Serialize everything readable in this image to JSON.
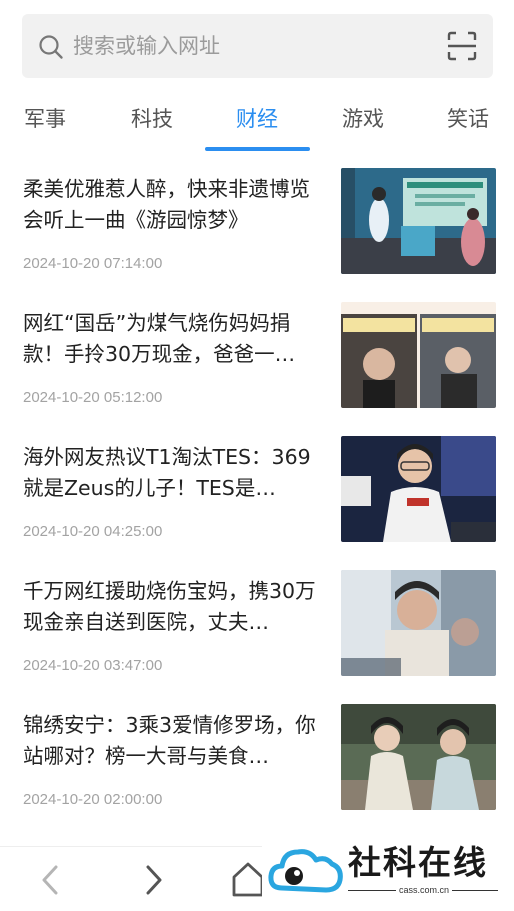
{
  "search": {
    "placeholder": "搜索或输入网址"
  },
  "tabs": [
    {
      "label": "军事"
    },
    {
      "label": "科技"
    },
    {
      "label": "财经"
    },
    {
      "label": "游戏"
    },
    {
      "label": "笑话"
    }
  ],
  "active_tab": "财经",
  "news": [
    {
      "title": "柔美优雅惹人醉，快来非遗博览会听上一曲《游园惊梦》",
      "time": "2024-10-20 07:14:00"
    },
    {
      "title": "网红“国岳”为煤气烧伤妈妈捐款！手拎30万现金，爸爸一…",
      "time": "2024-10-20 05:12:00"
    },
    {
      "title": "海外网友热议T1淘汰TES：369就是Zeus的儿子！TES是…",
      "time": "2024-10-20 04:25:00"
    },
    {
      "title": "千万网红援助烧伤宝妈，携30万现金亲自送到医院，丈夫…",
      "time": "2024-10-20 03:47:00"
    },
    {
      "title": "锦绣安宁：3乘3爱情修罗场，你站哪对？榜一大哥与美食…",
      "time": "2024-10-20 02:00:00"
    }
  ],
  "watermark": {
    "name": "社科在线",
    "url": "cass.com.cn"
  },
  "colors": {
    "accent": "#2b8ef0",
    "muted": "#a3a3a3",
    "search_bg": "#f1f1f1"
  }
}
